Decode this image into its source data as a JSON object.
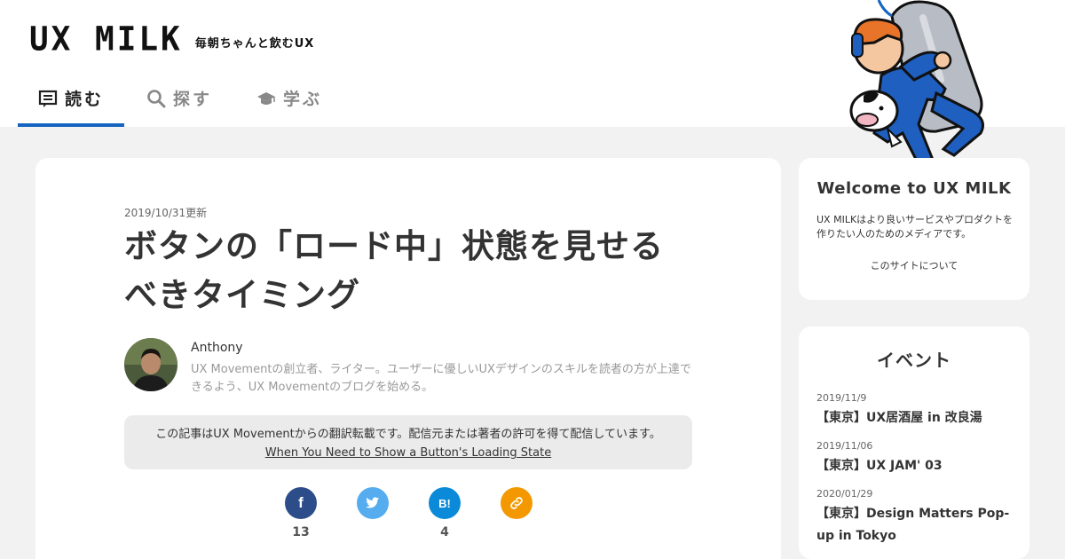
{
  "header": {
    "logo": "UX MILK",
    "tagline": "毎朝ちゃんと飲むUX",
    "nav": [
      {
        "label": "読む",
        "icon": "read-icon",
        "active": true
      },
      {
        "label": "探す",
        "icon": "search-icon",
        "active": false
      },
      {
        "label": "学ぶ",
        "icon": "graduation-cap-icon",
        "active": false
      }
    ]
  },
  "article": {
    "date": "2019/10/31更新",
    "title": "ボタンの「ロード中」状態を見せるべきタイミング",
    "author": {
      "name": "Anthony",
      "bio": "UX Movementの創立者、ライター。ユーザーに優しいUXデザインのスキルを読者の方が上達できるよう、UX Movementのブログを始める。"
    },
    "notice": {
      "text": "この記事はUX Movementからの翻訳転載です。配信元または著者の許可を得て配信しています。",
      "link": "When You Need to Show a Button's Loading State"
    },
    "share": [
      {
        "icon": "facebook-icon",
        "glyph": "f",
        "color": "#2d4d8a",
        "count": "13"
      },
      {
        "icon": "twitter-icon",
        "glyph": "",
        "color": "#55acee",
        "count": ""
      },
      {
        "icon": "hatena-bookmark-icon",
        "glyph": "B!",
        "color": "#0a8ad8",
        "count": "4"
      },
      {
        "icon": "link-icon",
        "glyph": "",
        "color": "#f39800",
        "count": ""
      }
    ]
  },
  "welcome": {
    "title": "Welcome to UX MILK",
    "description": "UX MILKはより良いサービスやプロダクトを作りたい人のためのメディアです。",
    "link": "このサイトについて"
  },
  "events": {
    "title": "イベント",
    "items": [
      {
        "date": "2019/11/9",
        "title": "【東京】UX居酒屋 in 改良湯"
      },
      {
        "date": "2019/11/06",
        "title": "【東京】UX JAM' 03"
      },
      {
        "date": "2020/01/29",
        "title": "【東京】Design Matters Pop-up in Tokyo"
      }
    ]
  },
  "colors": {
    "accent": "#1565c0",
    "background": "#f2f2f2"
  }
}
